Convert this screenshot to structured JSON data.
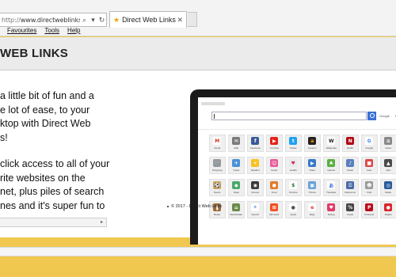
{
  "browser": {
    "address_prefix": "http://",
    "address_domain": "www.directweblinks.com/",
    "tab_title": "Direct Web Links",
    "menu": [
      "Favourites",
      "Tools",
      "Help"
    ]
  },
  "site": {
    "logo": "WEB LINKS",
    "paragraph1": [
      "a little bit of fun and a",
      "e lot of ease, to your",
      "ktop with Direct Web",
      "s!"
    ],
    "paragraph2": [
      "click access to all of your",
      "rite websites on the",
      "net, plus piles of search",
      "nes and it's super fun to"
    ],
    "footer": "© 2017 - Direct Web Links"
  },
  "mockup": {
    "search_label": "Google",
    "tiles": [
      {
        "label": "Gmail",
        "icon": "gmail-icon",
        "color": "#ffffff",
        "glyph": "M",
        "fg": "#d93025"
      },
      {
        "label": "Mail",
        "icon": "mail-icon",
        "color": "#7a7a7a",
        "glyph": "✉",
        "fg": "#ffffff"
      },
      {
        "label": "Facebook",
        "icon": "facebook-icon",
        "color": "#3b5998",
        "glyph": "f",
        "fg": "#ffffff"
      },
      {
        "label": "YouTube",
        "icon": "youtube-icon",
        "color": "#e62117",
        "glyph": "▶",
        "fg": "#ffffff"
      },
      {
        "label": "Twitter",
        "icon": "twitter-icon",
        "color": "#1da1f2",
        "glyph": "t",
        "fg": "#ffffff"
      },
      {
        "label": "Amazon",
        "icon": "amazon-icon",
        "color": "#222222",
        "glyph": "a",
        "fg": "#ff9900"
      },
      {
        "label": "Wikipedia",
        "icon": "wikipedia-icon",
        "color": "#ffffff",
        "glyph": "W",
        "fg": "#222222"
      },
      {
        "label": "Netflix",
        "icon": "netflix-icon",
        "color": "#b20710",
        "glyph": "N",
        "fg": "#ffffff"
      },
      {
        "label": "Google",
        "icon": "google-icon",
        "color": "#ffffff",
        "glyph": "G",
        "fg": "#4285f4"
      },
      {
        "label": "News",
        "icon": "news-icon",
        "color": "#888888",
        "glyph": "≡",
        "fg": "#ffffff"
      },
      {
        "label": "Shopping",
        "icon": "shopping-icon",
        "color": "#9a9a9a",
        "glyph": "🛒",
        "fg": "#ffffff"
      },
      {
        "label": "Travel",
        "icon": "travel-icon",
        "color": "#4a90d9",
        "glyph": "✈",
        "fg": "#ffffff"
      },
      {
        "label": "Weather",
        "icon": "weather-icon",
        "color": "#f6c21c",
        "glyph": "☀",
        "fg": "#ffffff"
      },
      {
        "label": "Social",
        "icon": "social-icon",
        "color": "#e85a9a",
        "glyph": "☺",
        "fg": "#ffffff"
      },
      {
        "label": "Health",
        "icon": "health-icon",
        "color": "#e8eaf0",
        "glyph": "♥",
        "fg": "#d9304a"
      },
      {
        "label": "Video",
        "icon": "video-icon",
        "color": "#3778c9",
        "glyph": "▶",
        "fg": "#ffffff"
      },
      {
        "label": "Games",
        "icon": "games-icon",
        "color": "#5ab043",
        "glyph": "♣",
        "fg": "#ffffff"
      },
      {
        "label": "Music",
        "icon": "music-icon",
        "color": "#5a7fbd",
        "glyph": "♪",
        "fg": "#ffffff"
      },
      {
        "label": "Cars",
        "icon": "cars-icon",
        "color": "#d94a4a",
        "glyph": "■",
        "fg": "#ffffff"
      },
      {
        "label": "Jobs",
        "icon": "jobs-icon",
        "color": "#4a4a4a",
        "glyph": "▲",
        "fg": "#ffffff"
      },
      {
        "label": "Sports",
        "icon": "sports-icon",
        "color": "#c8a25a",
        "glyph": "⚽",
        "fg": "#ffffff"
      },
      {
        "label": "Maps",
        "icon": "maps-icon",
        "color": "#4aa86a",
        "glyph": "◆",
        "fg": "#ffffff"
      },
      {
        "label": "Movies",
        "icon": "movies-icon",
        "color": "#3a3a3a",
        "glyph": "◉",
        "fg": "#ffffff"
      },
      {
        "label": "Food",
        "icon": "food-icon",
        "color": "#e07a2c",
        "glyph": "●",
        "fg": "#ffffff"
      },
      {
        "label": "Finance",
        "icon": "finance-icon",
        "color": "#ffffff",
        "glyph": "$",
        "fg": "#2a7a2a"
      },
      {
        "label": "Photos",
        "icon": "photos-icon",
        "color": "#6aa0d8",
        "glyph": "▣",
        "fg": "#ffffff"
      },
      {
        "label": "Translate",
        "icon": "translate-icon",
        "color": "#ffffff",
        "glyph": "あ",
        "fg": "#3a6fd8"
      },
      {
        "label": "Reference",
        "icon": "reference-icon",
        "color": "#4a6aa8",
        "glyph": "☰",
        "fg": "#ffffff"
      },
      {
        "label": "Kids",
        "icon": "kids-icon",
        "color": "#9a9a9a",
        "glyph": "☻",
        "fg": "#ffffff"
      },
      {
        "label": "Radio",
        "icon": "radio-icon",
        "color": "#2a5a9a",
        "glyph": "◎",
        "fg": "#ffffff"
      },
      {
        "label": "Books",
        "icon": "books-icon",
        "color": "#9a6a3a",
        "glyph": "❚",
        "fg": "#ffffff"
      },
      {
        "label": "Real Estate",
        "icon": "real-estate-icon",
        "color": "#6a8a4a",
        "glyph": "⌂",
        "fg": "#ffffff"
      },
      {
        "label": "Search",
        "icon": "search-icon",
        "color": "#ffffff",
        "glyph": "⌕",
        "fg": "#3a6fd8"
      },
      {
        "label": "Microsoft",
        "icon": "microsoft-icon",
        "color": "#f25022",
        "glyph": "⊞",
        "fg": "#ffffff"
      },
      {
        "label": "Apple",
        "icon": "apple-icon",
        "color": "#ffffff",
        "glyph": "●",
        "fg": "#555555"
      },
      {
        "label": "Ebay",
        "icon": "ebay-icon",
        "color": "#ffffff",
        "glyph": "e",
        "fg": "#e53238"
      },
      {
        "label": "Dating",
        "icon": "dating-icon",
        "color": "#e03a6a",
        "glyph": "♥",
        "fg": "#ffffff"
      },
      {
        "label": "Deals",
        "icon": "deals-icon",
        "color": "#444444",
        "glyph": "%",
        "fg": "#ffffff"
      },
      {
        "label": "Pinterest",
        "icon": "pinterest-icon",
        "color": "#bd081c",
        "glyph": "P",
        "fg": "#ffffff"
      },
      {
        "label": "Flights",
        "icon": "flights-icon",
        "color": "#d8262a",
        "glyph": "●",
        "fg": "#ffffff"
      }
    ]
  }
}
